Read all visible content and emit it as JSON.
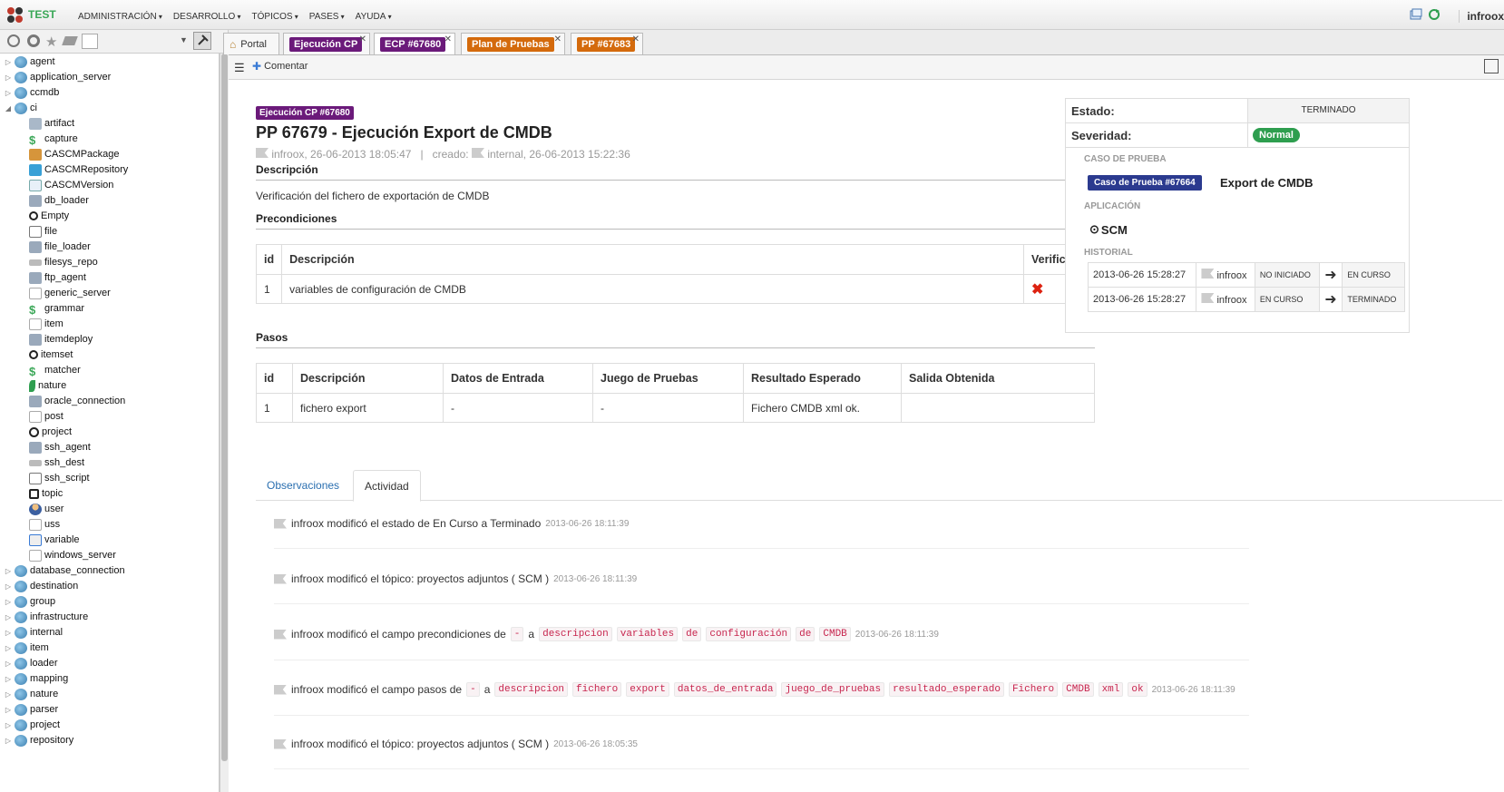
{
  "app": {
    "name": "TEST",
    "user": "infroox",
    "menu": [
      "ADMINISTRACIÓN",
      "DESARROLLO",
      "TÓPICOS",
      "PASES",
      "AYUDA"
    ]
  },
  "tree": [
    {
      "label": "agent",
      "depth": 0,
      "icon": "folder-icon"
    },
    {
      "label": "application_server",
      "depth": 0,
      "icon": "folder-icon"
    },
    {
      "label": "ccmdb",
      "depth": 0,
      "icon": "folder-icon"
    },
    {
      "label": "ci",
      "depth": 0,
      "icon": "folder-icon",
      "open": true
    },
    {
      "label": "artifact",
      "depth": 1,
      "icon": "artifact-icon"
    },
    {
      "label": "capture",
      "depth": 1,
      "icon": "dollar-icon"
    },
    {
      "label": "CASCMPackage",
      "depth": 1,
      "icon": "package-icon"
    },
    {
      "label": "CASCMRepository",
      "depth": 1,
      "icon": "repository-icon"
    },
    {
      "label": "CASCMVersion",
      "depth": 1,
      "icon": "version-icon"
    },
    {
      "label": "db_loader",
      "depth": 1,
      "icon": "loader-icon"
    },
    {
      "label": "Empty",
      "depth": 1,
      "icon": "circle-icon"
    },
    {
      "label": "file",
      "depth": 1,
      "icon": "file-icon"
    },
    {
      "label": "file_loader",
      "depth": 1,
      "icon": "loader-icon"
    },
    {
      "label": "filesys_repo",
      "depth": 1,
      "icon": "disk-icon"
    },
    {
      "label": "ftp_agent",
      "depth": 1,
      "icon": "loader-icon"
    },
    {
      "label": "generic_server",
      "depth": 1,
      "icon": "page-icon"
    },
    {
      "label": "grammar",
      "depth": 1,
      "icon": "dollar-icon"
    },
    {
      "label": "item",
      "depth": 1,
      "icon": "page-icon"
    },
    {
      "label": "itemdeploy",
      "depth": 1,
      "icon": "loader-icon"
    },
    {
      "label": "itemset",
      "depth": 1,
      "icon": "circle-icon"
    },
    {
      "label": "matcher",
      "depth": 1,
      "icon": "dollar-icon"
    },
    {
      "label": "nature",
      "depth": 1,
      "icon": "leaf-icon"
    },
    {
      "label": "oracle_connection",
      "depth": 1,
      "icon": "loader-icon"
    },
    {
      "label": "post",
      "depth": 1,
      "icon": "page-icon"
    },
    {
      "label": "project",
      "depth": 1,
      "icon": "target-icon"
    },
    {
      "label": "ssh_agent",
      "depth": 1,
      "icon": "loader-icon"
    },
    {
      "label": "ssh_dest",
      "depth": 1,
      "icon": "disk-icon"
    },
    {
      "label": "ssh_script",
      "depth": 1,
      "icon": "script-icon"
    },
    {
      "label": "topic",
      "depth": 1,
      "icon": "square-icon"
    },
    {
      "label": "user",
      "depth": 1,
      "icon": "user-icon"
    },
    {
      "label": "uss",
      "depth": 1,
      "icon": "page-icon"
    },
    {
      "label": "variable",
      "depth": 1,
      "icon": "variable-icon"
    },
    {
      "label": "windows_server",
      "depth": 1,
      "icon": "page-icon"
    },
    {
      "label": "database_connection",
      "depth": 0,
      "icon": "folder-icon"
    },
    {
      "label": "destination",
      "depth": 0,
      "icon": "folder-icon"
    },
    {
      "label": "group",
      "depth": 0,
      "icon": "folder-icon"
    },
    {
      "label": "infrastructure",
      "depth": 0,
      "icon": "folder-icon"
    },
    {
      "label": "internal",
      "depth": 0,
      "icon": "folder-icon"
    },
    {
      "label": "item",
      "depth": 0,
      "icon": "folder-icon"
    },
    {
      "label": "loader",
      "depth": 0,
      "icon": "folder-icon"
    },
    {
      "label": "mapping",
      "depth": 0,
      "icon": "folder-icon"
    },
    {
      "label": "nature",
      "depth": 0,
      "icon": "folder-icon"
    },
    {
      "label": "parser",
      "depth": 0,
      "icon": "folder-icon"
    },
    {
      "label": "project",
      "depth": 0,
      "icon": "folder-icon"
    },
    {
      "label": "repository",
      "depth": 0,
      "icon": "folder-icon"
    }
  ],
  "tabs": [
    {
      "label": "Portal",
      "color": ""
    },
    {
      "label": "Ejecución CP",
      "color": "#6b1a7a"
    },
    {
      "label": "ECP #67680",
      "color": "#6b1a7a"
    },
    {
      "label": "Plan de Pruebas",
      "color": "#d46a0c"
    },
    {
      "label": "PP #67683",
      "color": "#d46a0c"
    }
  ],
  "toolbar": {
    "comment": "Comentar"
  },
  "doc": {
    "badge": "Ejecución CP #67680",
    "title": "PP 67679 - Ejecución Export de CMDB",
    "author": "infroox, 26-06-2013 18:05:47",
    "created_label": "creado:",
    "created": "internal, 26-06-2013 15:22:36",
    "desc_title": "Descripción",
    "desc": "Verificación del fichero de exportación de CMDB",
    "pre_title": "Precondiciones",
    "pre_headers": [
      "id",
      "Descripción",
      "Verificado"
    ],
    "pre_row": {
      "id": "1",
      "desc": "variables de configuración de CMDB",
      "verified": "✖"
    },
    "steps_title": "Pasos",
    "steps_headers": [
      "id",
      "Descripción",
      "Datos de Entrada",
      "Juego de Pruebas",
      "Resultado Esperado",
      "Salida Obtenida"
    ],
    "steps_row": [
      "1",
      "fichero export",
      "-",
      "-",
      "Fichero CMDB xml ok.",
      ""
    ]
  },
  "panel_tabs": [
    "Observaciones",
    "Actividad"
  ],
  "activity": [
    {
      "pre": "infroox modificó el estado de En Curso a Terminado",
      "codes": [],
      "ts": "2013-06-26 18:11:39"
    },
    {
      "pre": "infroox modificó el tópico: proyectos adjuntos ( SCM )",
      "codes": [],
      "ts": "2013-06-26 18:11:39"
    },
    {
      "pre": "infroox modificó el campo precondiciones de",
      "from": "-",
      "mid": "a",
      "codes": [
        "descripcion",
        "variables",
        "de",
        "configuración",
        "de",
        "CMDB"
      ],
      "ts": "2013-06-26 18:11:39"
    },
    {
      "pre": "infroox modificó el campo pasos de",
      "from": "-",
      "mid": "a",
      "codes": [
        "descripcion",
        "fichero",
        "export",
        "datos_de_entrada",
        "juego_de_pruebas",
        "resultado_esperado",
        "Fichero",
        "CMDB",
        "xml",
        "ok"
      ],
      "ts": "2013-06-26 18:11:39"
    },
    {
      "pre": "infroox modificó el tópico: proyectos adjuntos ( SCM )",
      "codes": [],
      "ts": "2013-06-26 18:05:35"
    }
  ],
  "side": {
    "estado_label": "Estado:",
    "estado": "TERMINADO",
    "sev_label": "Severidad:",
    "sev": "Normal",
    "case_cap": "CASO DE PRUEBA",
    "case_badge": "Caso de Prueba #67664",
    "case_name": "Export de CMDB",
    "app_cap": "APLICACIÓN",
    "app": "SCM",
    "hist_cap": "HISTORIAL",
    "history": [
      {
        "ts": "2013-06-26 15:28:27",
        "user": "infroox",
        "from": "NO INICIADO",
        "to": "EN CURSO"
      },
      {
        "ts": "2013-06-26 15:28:27",
        "user": "infroox",
        "from": "EN CURSO",
        "to": "TERMINADO"
      }
    ]
  },
  "colors": {
    "purple": "#6b1a7a",
    "orange": "#d46a0c",
    "green": "#2e9e4f",
    "navy": "#2b3a8f"
  }
}
